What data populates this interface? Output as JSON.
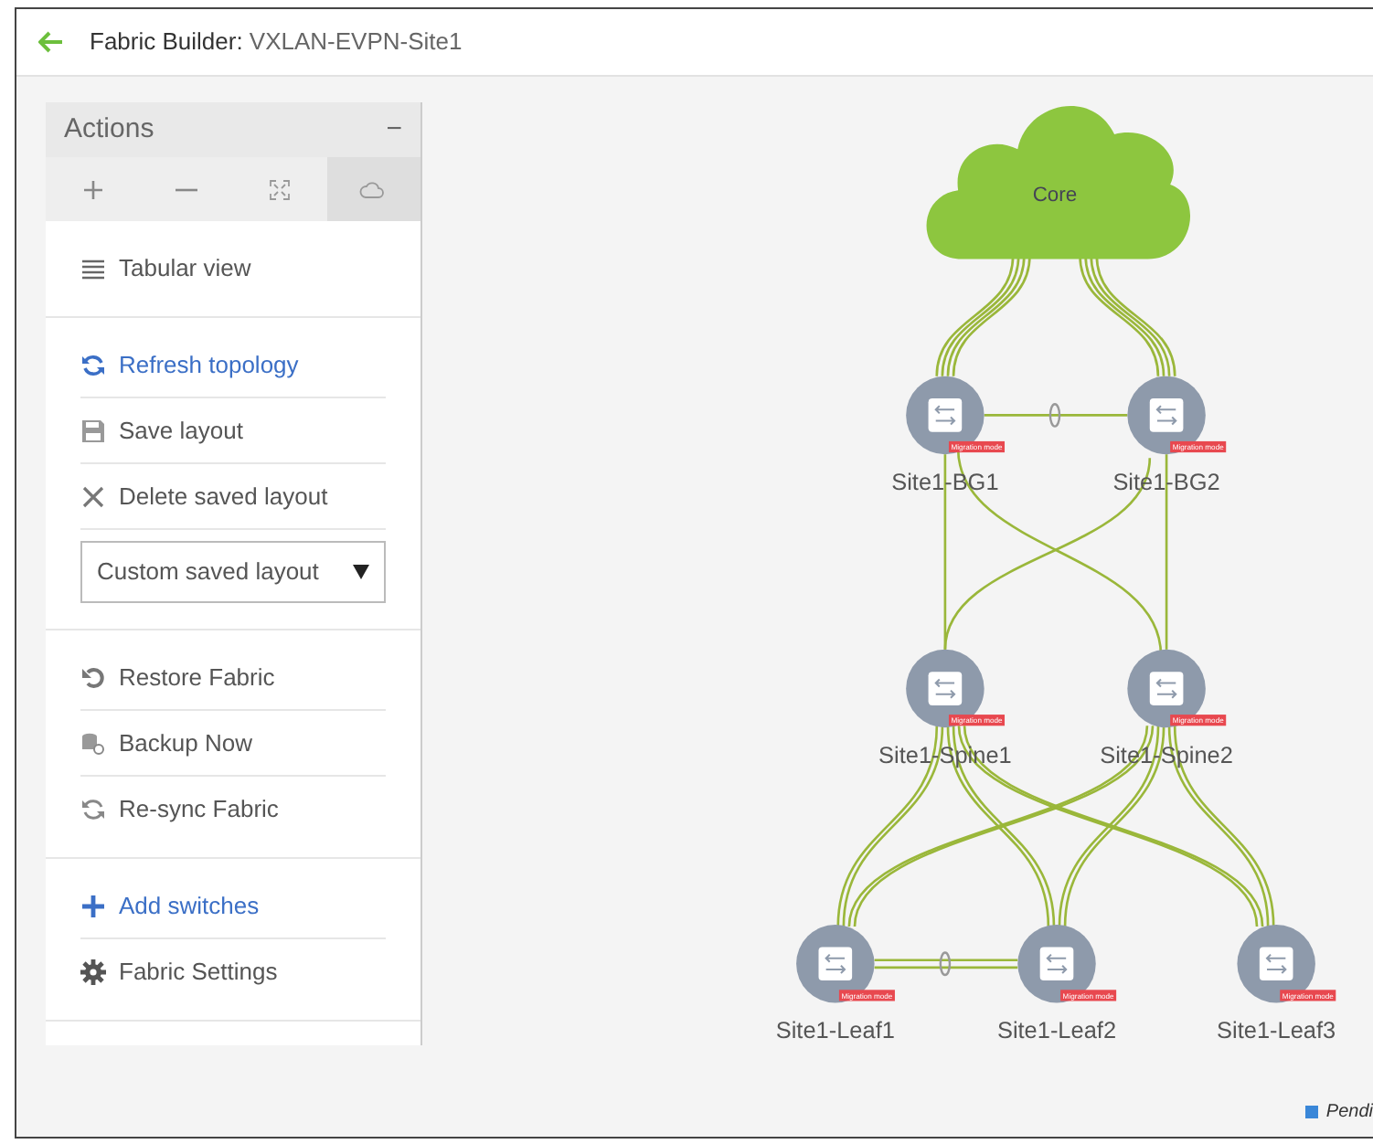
{
  "header": {
    "title_label": "Fabric Builder:",
    "title_value": "VXLAN-EVPN-Site1"
  },
  "actions_panel": {
    "title": "Actions",
    "collapse": "−",
    "toolbar": [
      {
        "kind": "plus",
        "selected": false
      },
      {
        "kind": "minus",
        "selected": false
      },
      {
        "kind": "fit",
        "selected": false
      },
      {
        "kind": "cloud",
        "selected": true
      }
    ],
    "sections": [
      [
        {
          "kind": "list",
          "label": "Tabular view",
          "link": false
        }
      ],
      [
        {
          "kind": "refresh",
          "label": "Refresh topology",
          "link": true
        },
        {
          "kind": "save",
          "label": "Save layout",
          "link": false
        },
        {
          "kind": "delete",
          "label": "Delete saved layout",
          "link": false
        },
        {
          "kind": "select",
          "label": "Custom saved layout",
          "link": false
        }
      ],
      [
        {
          "kind": "restore",
          "label": "Restore Fabric",
          "link": false
        },
        {
          "kind": "backup",
          "label": "Backup Now",
          "link": false
        },
        {
          "kind": "resync",
          "label": "Re-sync Fabric",
          "link": false
        }
      ],
      [
        {
          "kind": "add",
          "label": "Add switches",
          "link": true
        },
        {
          "kind": "settings",
          "label": "Fabric Settings",
          "link": false
        }
      ]
    ]
  },
  "topology": {
    "core": {
      "label": "Core"
    },
    "nodes": [
      {
        "label": "Site1-BG1",
        "badge": "Migration mode"
      },
      {
        "label": "Site1-BG2",
        "badge": "Migration mode"
      },
      {
        "label": "Site1-Spine1",
        "badge": "Migration mode"
      },
      {
        "label": "Site1-Spine2",
        "badge": "Migration mode"
      },
      {
        "label": "Site1-Leaf1",
        "badge": "Migration mode"
      },
      {
        "label": "Site1-Leaf2",
        "badge": "Migration mode"
      },
      {
        "label": "Site1-Leaf3",
        "badge": "Migration mode"
      }
    ],
    "legend": [
      {
        "label": "Pendi",
        "color": "#3a87d8"
      }
    ]
  }
}
